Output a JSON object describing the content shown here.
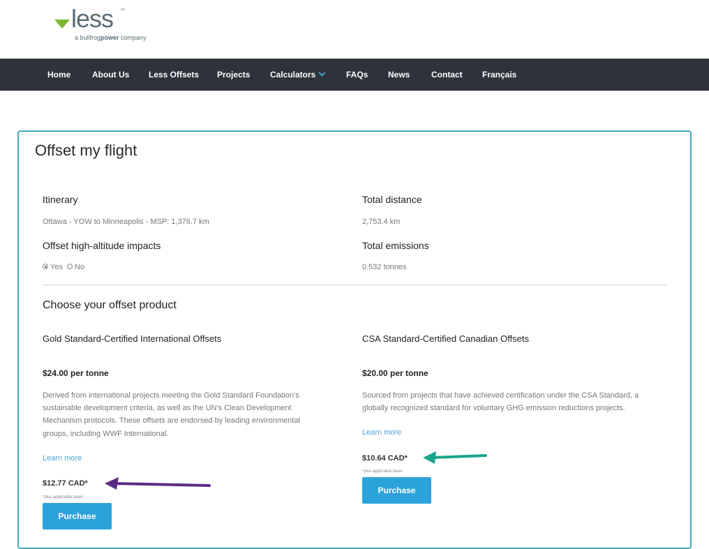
{
  "brand": {
    "wordmark": "less",
    "trademark": "™",
    "tagline_prefix": "a bullfrog",
    "tagline_bold": "power",
    "tagline_suffix": " company",
    "accent_green": "#7cb82f"
  },
  "nav": {
    "items": [
      {
        "label": "Home"
      },
      {
        "label": "About Us"
      },
      {
        "label": "Less Offsets"
      },
      {
        "label": "Projects"
      },
      {
        "label": "Calculators"
      },
      {
        "label": "FAQs"
      },
      {
        "label": "News"
      },
      {
        "label": "Contact"
      },
      {
        "label": "Français"
      }
    ],
    "background": "#2e333b"
  },
  "page": {
    "title": "Offset my flight",
    "itinerary_label": "Itinerary",
    "itinerary_value": "Ottawa - YOW to Minneapolis - MSP: 1,376.7 km",
    "distance_label": "Total distance",
    "distance_value": "2,753.4 km",
    "altitude_label": "Offset high-altitude impacts",
    "altitude_yes": "Yes",
    "altitude_no": "No",
    "altitude_selected": "Yes",
    "emissions_label": "Total emissions",
    "emissions_value": "0.532 tonnes",
    "choose_title": "Choose your offset product"
  },
  "products": [
    {
      "title": "Gold Standard-Certified International Offsets",
      "price": "$24.00 per tonne",
      "description": "Derived from international projects meeting the Gold Standard Foundation's sustainable development criteria, as well as the UN's Clean Development Mechanism protocols. These offsets are endorsed by leading environmental groups, including WWF International.",
      "learn_more": "Learn more",
      "total": "$12.77 CAD*",
      "tax_note": "*plus applicable taxes",
      "button": "Purchase"
    },
    {
      "title": "CSA Standard-Certified Canadian Offsets",
      "price": "$20.00 per tonne",
      "description": "Sourced from projects that have achieved certification under the CSA Standard, a globally recognized standard for voluntary GHG emission reductions projects.",
      "learn_more": "Learn more",
      "total": "$10.64 CAD*",
      "tax_note": "*plus applicable taxes",
      "button": "Purchase"
    }
  ],
  "annotations": {
    "left_arrow_color": "#5b2a86",
    "right_arrow_color": "#1aa58a"
  },
  "colors": {
    "panel_border": "#3fa8b8",
    "button": "#2ba3da",
    "link": "#4fa3d9"
  }
}
